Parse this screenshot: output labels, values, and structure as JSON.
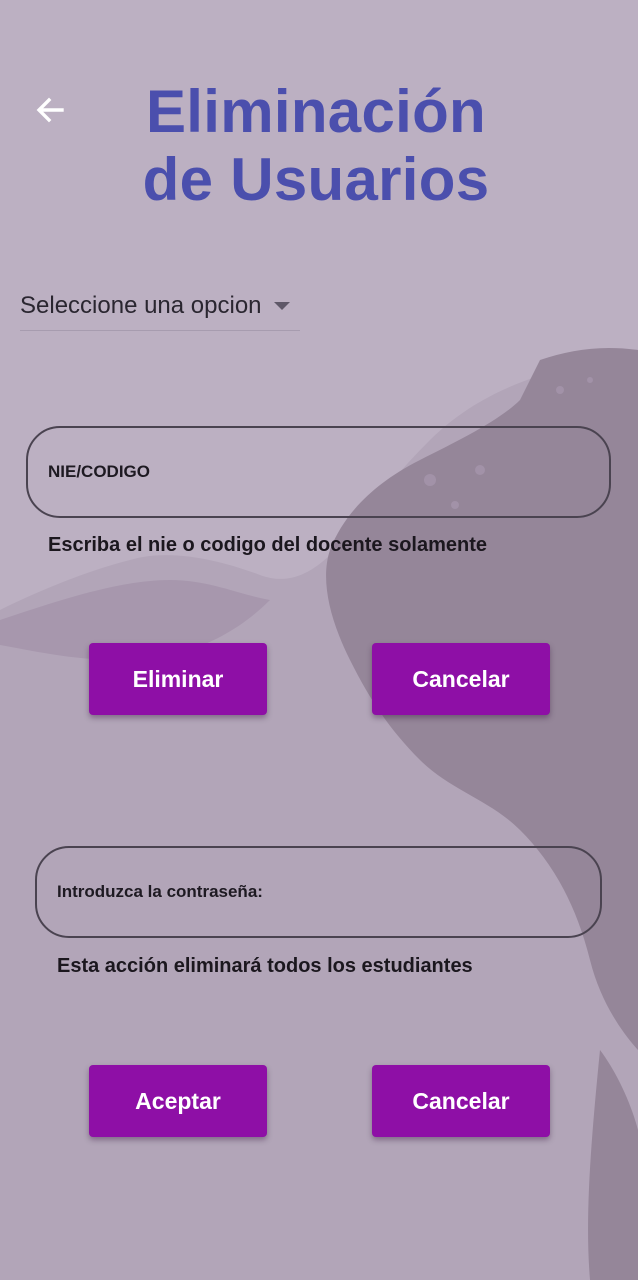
{
  "header": {
    "back_icon": "arrow-left-icon",
    "title_line1": "Eliminación",
    "title_line2": "de Usuarios"
  },
  "dropdown": {
    "selected": "Seleccione una opcion",
    "icon": "caret-down-icon"
  },
  "single_delete": {
    "field_label": "NIE/CODIGO",
    "helper": "Escriba el nie o codigo del docente solamente",
    "delete_label": "Eliminar",
    "cancel_label": "Cancelar"
  },
  "bulk_delete": {
    "field_label": "Introduzca la contraseña:",
    "helper": "Esta acción eliminará todos los estudiantes",
    "accept_label": "Aceptar",
    "cancel_label": "Cancelar"
  },
  "colors": {
    "title": "#4b4fad",
    "button": "#8e0fa6",
    "background": "#b9adbf",
    "map_shade": "#958699"
  }
}
